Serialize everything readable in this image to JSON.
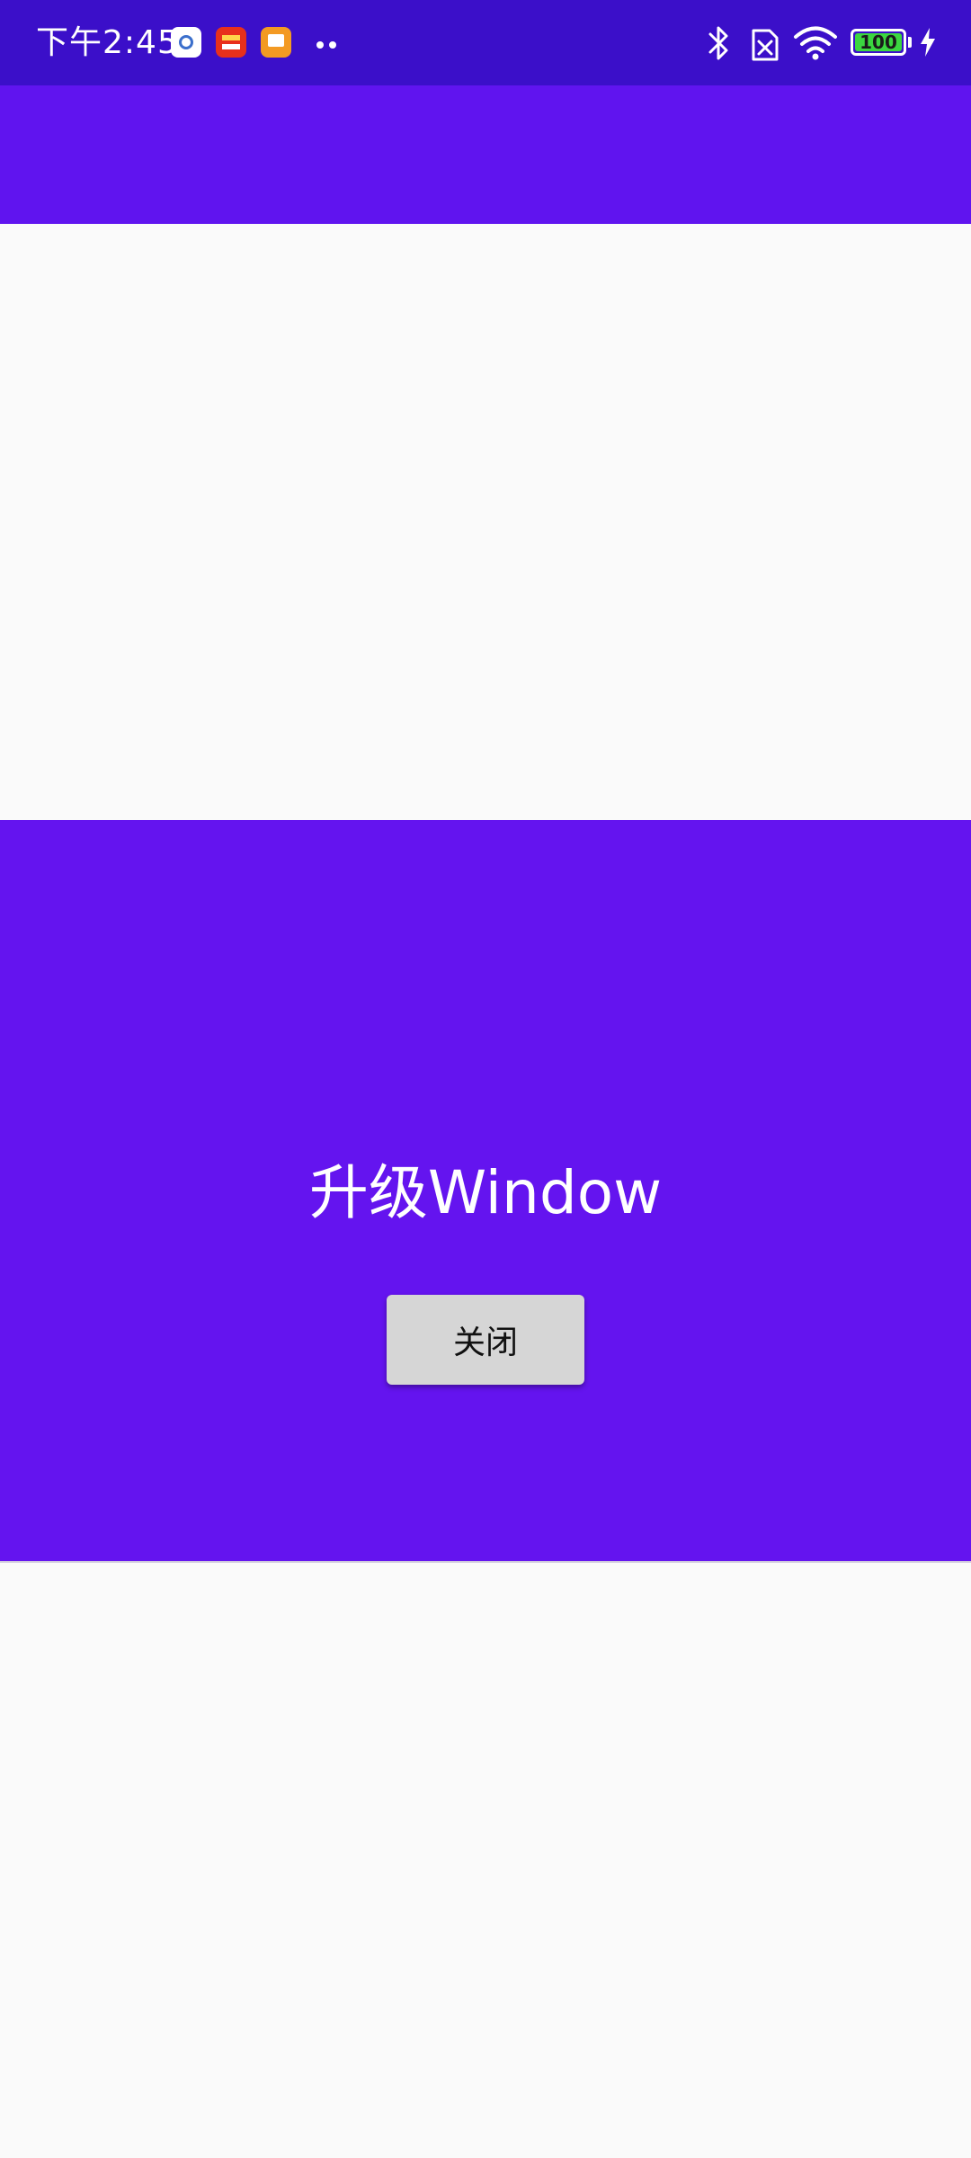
{
  "status_bar": {
    "time": "下午2:45",
    "battery_level": "100",
    "battery_fraction": 1.0,
    "notification_icons": [
      "settings-app-icon",
      "shopping-app-icon",
      "reading-app-icon"
    ],
    "system_icons": [
      "bluetooth-icon",
      "no-sim-icon",
      "wifi-icon",
      "battery-icon",
      "charging-icon"
    ]
  },
  "colors": {
    "status_bar": "#3B0FC9",
    "toolbar": "#6014EF",
    "popup_background": "#6414EF",
    "content_background": "#FAFAFA",
    "button_background": "#D6D6D6",
    "battery_fill": "#3BD640"
  },
  "popup": {
    "title": "升级Window",
    "close_button_label": "关闭"
  }
}
